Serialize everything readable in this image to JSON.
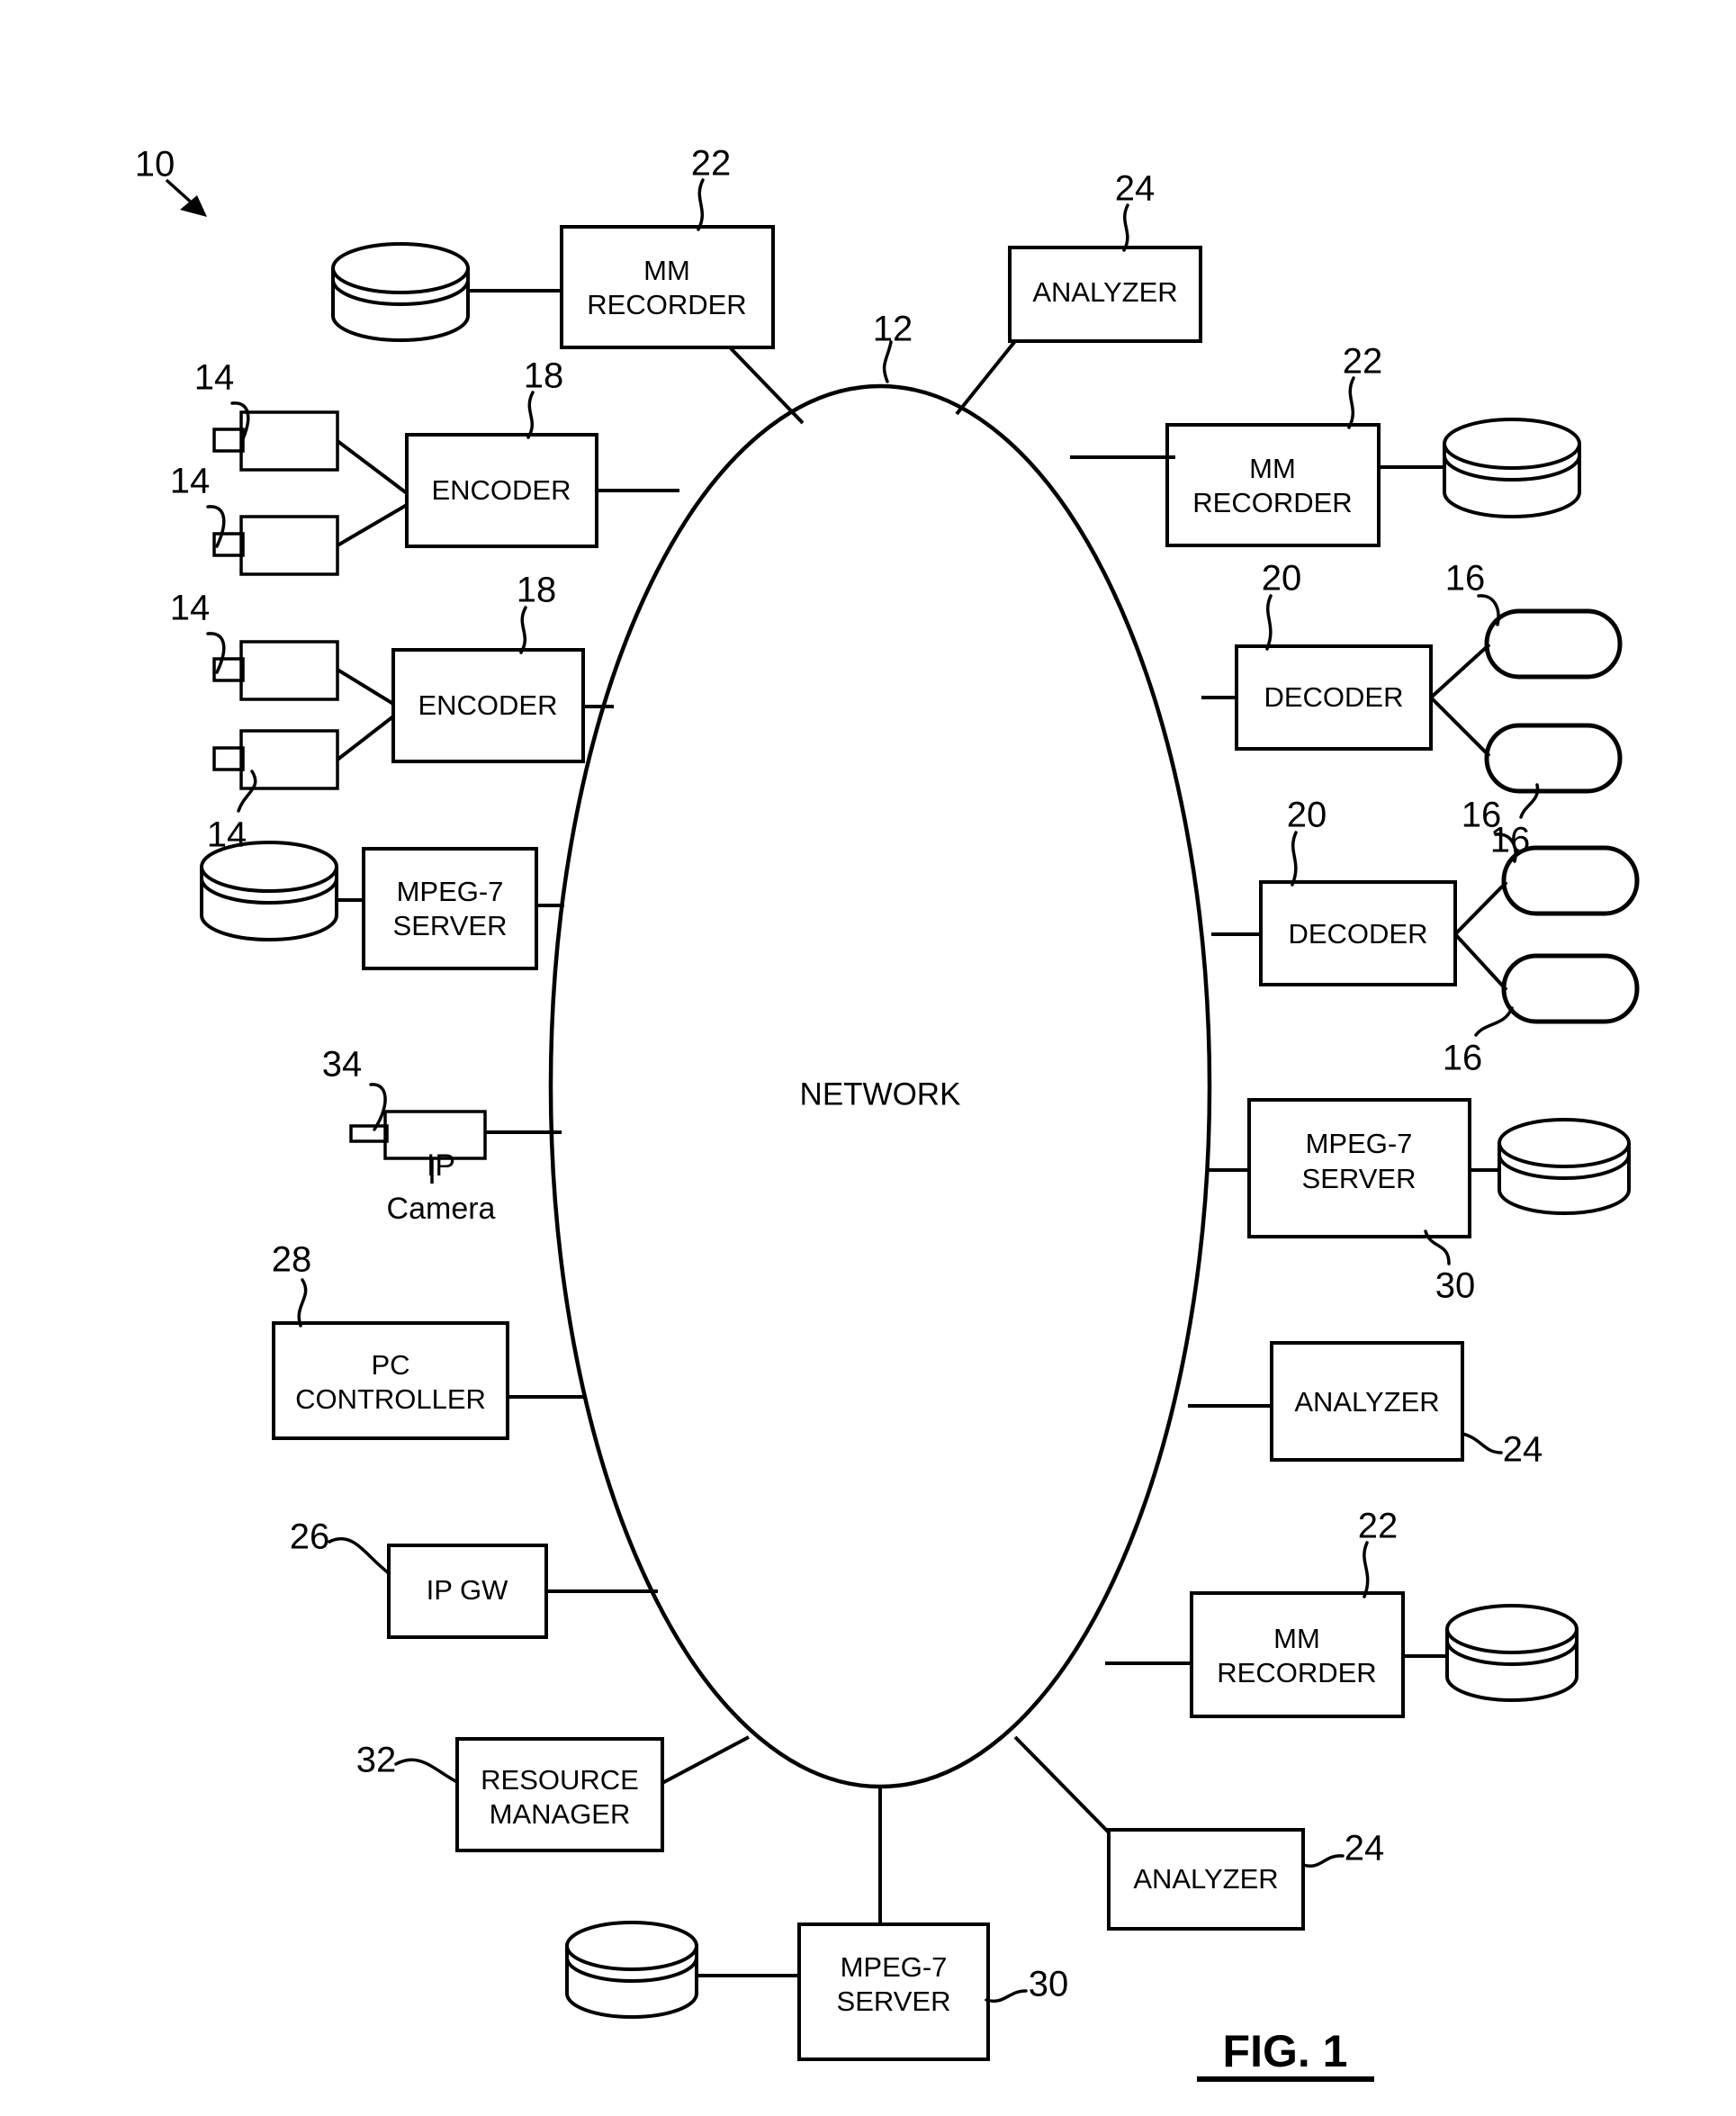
{
  "figure": {
    "caption": "FIG. 1",
    "system_ref": "10",
    "network_label": "NETWORK",
    "network_ref": "12"
  },
  "nodes": {
    "mm_recorder_top_left": {
      "label_line1": "MM",
      "label_line2": "RECORDER",
      "ref": "22"
    },
    "analyzer_top": {
      "label": "ANALYZER",
      "ref": "24"
    },
    "mm_recorder_top_right": {
      "label_line1": "MM",
      "label_line2": "RECORDER",
      "ref": "22"
    },
    "encoder_upper": {
      "label": "ENCODER",
      "ref": "18"
    },
    "encoder_lower": {
      "label": "ENCODER",
      "ref": "18"
    },
    "camera_1": {
      "ref": "14"
    },
    "camera_2": {
      "ref": "14"
    },
    "camera_3": {
      "ref": "14"
    },
    "camera_4": {
      "ref": "14"
    },
    "decoder_upper": {
      "label": "DECODER",
      "ref": "20"
    },
    "decoder_lower": {
      "label": "DECODER",
      "ref": "20"
    },
    "monitor_1": {
      "ref": "16"
    },
    "monitor_2": {
      "ref": "16"
    },
    "monitor_3": {
      "ref": "16"
    },
    "monitor_4": {
      "ref": "16"
    },
    "mpeg7_server_left": {
      "label_line1": "MPEG-7",
      "label_line2": "SERVER"
    },
    "mpeg7_server_right": {
      "label_line1": "MPEG-7",
      "label_line2": "SERVER",
      "ref": "30"
    },
    "mpeg7_server_bottom": {
      "label_line1": "MPEG-7",
      "label_line2": "SERVER",
      "ref": "30"
    },
    "ip_camera": {
      "label_line1": "IP",
      "label_line2": "Camera",
      "ref": "34"
    },
    "pc_controller": {
      "label_line1": "PC",
      "label_line2": "CONTROLLER",
      "ref": "28"
    },
    "ip_gw": {
      "label": "IP GW",
      "ref": "26"
    },
    "resource_manager": {
      "label_line1": "RESOURCE",
      "label_line2": "MANAGER",
      "ref": "32"
    },
    "analyzer_mid_right": {
      "label": "ANALYZER",
      "ref": "24"
    },
    "mm_recorder_bottom_right": {
      "label_line1": "MM",
      "label_line2": "RECORDER",
      "ref": "22"
    },
    "analyzer_bottom_right": {
      "label": "ANALYZER",
      "ref": "24"
    }
  },
  "colors": {
    "ink": "#000000",
    "paper": "#ffffff"
  }
}
